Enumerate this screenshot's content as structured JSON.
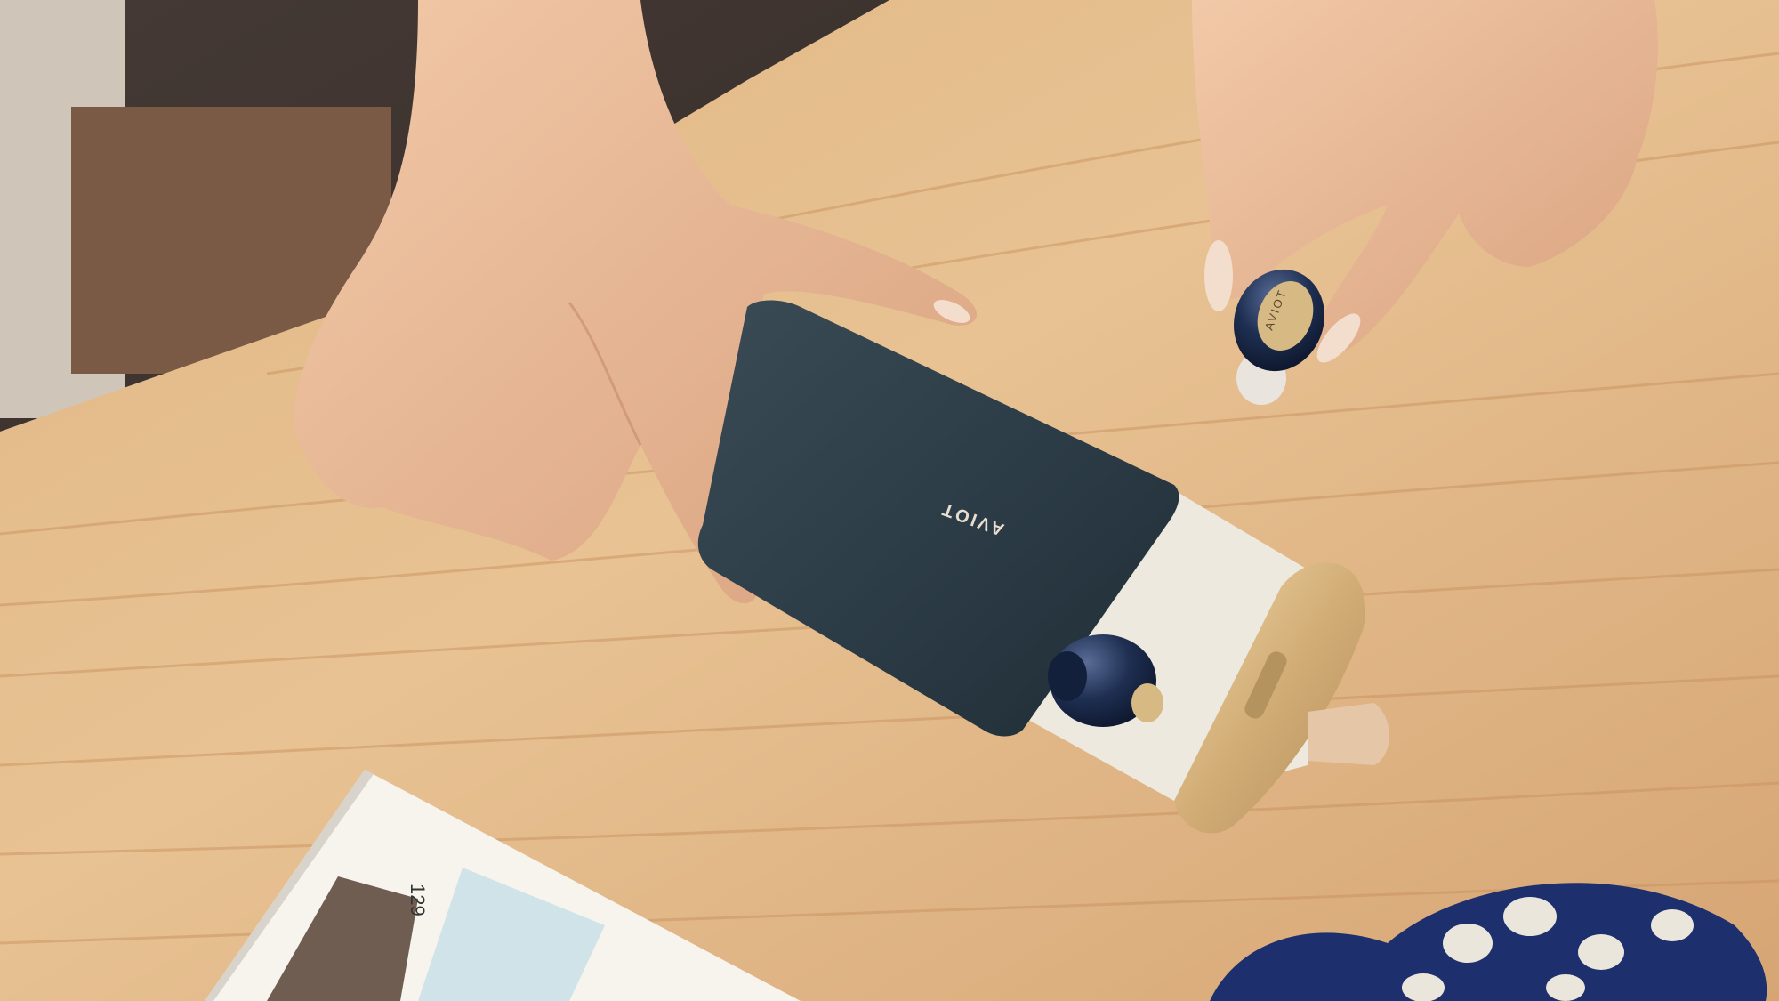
{
  "scene": {
    "case_brand_text": "AVIOT",
    "earbud_brand_text": "AVIOT",
    "booklet_page_number": "129"
  },
  "colors": {
    "table_light": "#e6bf8f",
    "table_mid": "#d3a472",
    "table_dark": "#b98552",
    "case_navy": "#2a3a43",
    "case_gold": "#d4b07a",
    "case_inner": "#eee9df",
    "earbud_navy": "#1a2a45",
    "skin": "#e8b896",
    "background_dark": "#2a2220"
  }
}
